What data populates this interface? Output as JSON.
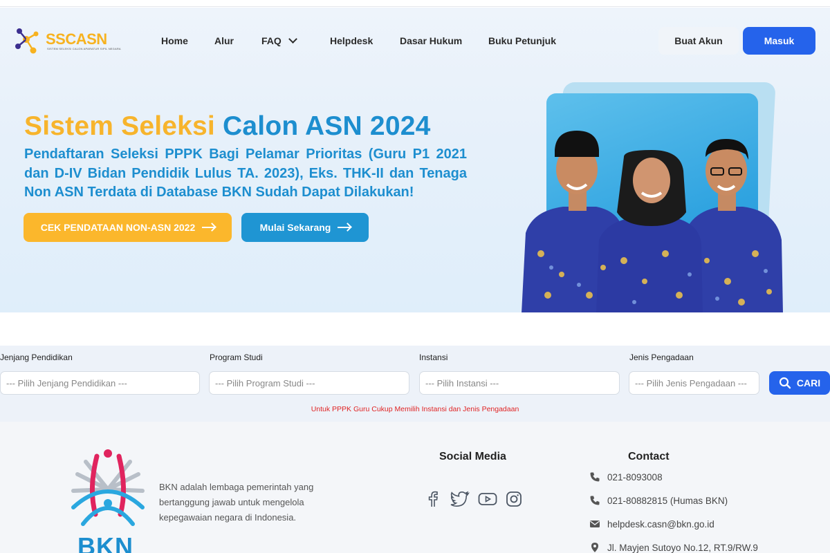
{
  "brand": {
    "name_part1": "SSC",
    "name_part2": "ASN",
    "tagline": "SISTEM SELEKSI CALON APARATUR SIPIL NEGARA"
  },
  "nav": {
    "items": [
      {
        "label": "Home"
      },
      {
        "label": "Alur"
      },
      {
        "label": "FAQ"
      },
      {
        "label": "Helpdesk"
      },
      {
        "label": "Dasar Hukum"
      },
      {
        "label": "Buku Petunjuk"
      }
    ],
    "register_label": "Buat Akun",
    "login_label": "Masuk"
  },
  "hero": {
    "title_part1": "Sistem Seleksi",
    "title_part2": "Calon ASN 2024",
    "subtitle": "Pendaftaran Seleksi PPPK Bagi Pelamar Prioritas (Guru P1 2021 dan D-IV Bidan Pendidik Lulus TA. 2023), Eks. THK-II dan Tenaga Non ASN Terdata di Database BKN Sudah Dapat Dilakukan!",
    "primary_button": "CEK PENDATAAN NON-ASN 2022",
    "secondary_button": "Mulai Sekarang"
  },
  "filter": {
    "fields": [
      {
        "label": "Jenjang Pendidikan",
        "placeholder": "--- Pilih Jenjang Pendidikan ---"
      },
      {
        "label": "Program Studi",
        "placeholder": "--- Pilih Program Studi ---"
      },
      {
        "label": "Instansi",
        "placeholder": "--- Pilih Instansi ---"
      },
      {
        "label": "Jenis Pengadaan",
        "placeholder": "--- Pilih Jenis Pengadaan ---"
      }
    ],
    "search_button": "CARI",
    "note": "Untuk PPPK Guru Cukup Memilih Instansi dan Jenis Pengadaan"
  },
  "footer": {
    "logo_text": "BKN",
    "about": "BKN adalah lembaga pemerintah yang bertanggung jawab untuk mengelola kepegawaian negara di Indonesia.",
    "social_title": "Social Media",
    "social_icons": [
      "facebook-icon",
      "twitter-icon",
      "youtube-icon",
      "instagram-icon"
    ],
    "contact_title": "Contact",
    "contacts": [
      {
        "icon": "phone-icon",
        "text": "021-8093008"
      },
      {
        "icon": "phone-icon",
        "text": "021-80882815 (Humas BKN)"
      },
      {
        "icon": "mail-icon",
        "text": "helpdesk.casn@bkn.go.id"
      },
      {
        "icon": "location-icon",
        "text": "Jl. Mayjen Sutoyo No.12, RT.9/RW.9"
      }
    ]
  },
  "colors": {
    "accent_blue": "#2563eb",
    "brand_yellow": "#fbb72c",
    "brand_sky": "#1d8ecf",
    "note_red": "#e02424"
  }
}
